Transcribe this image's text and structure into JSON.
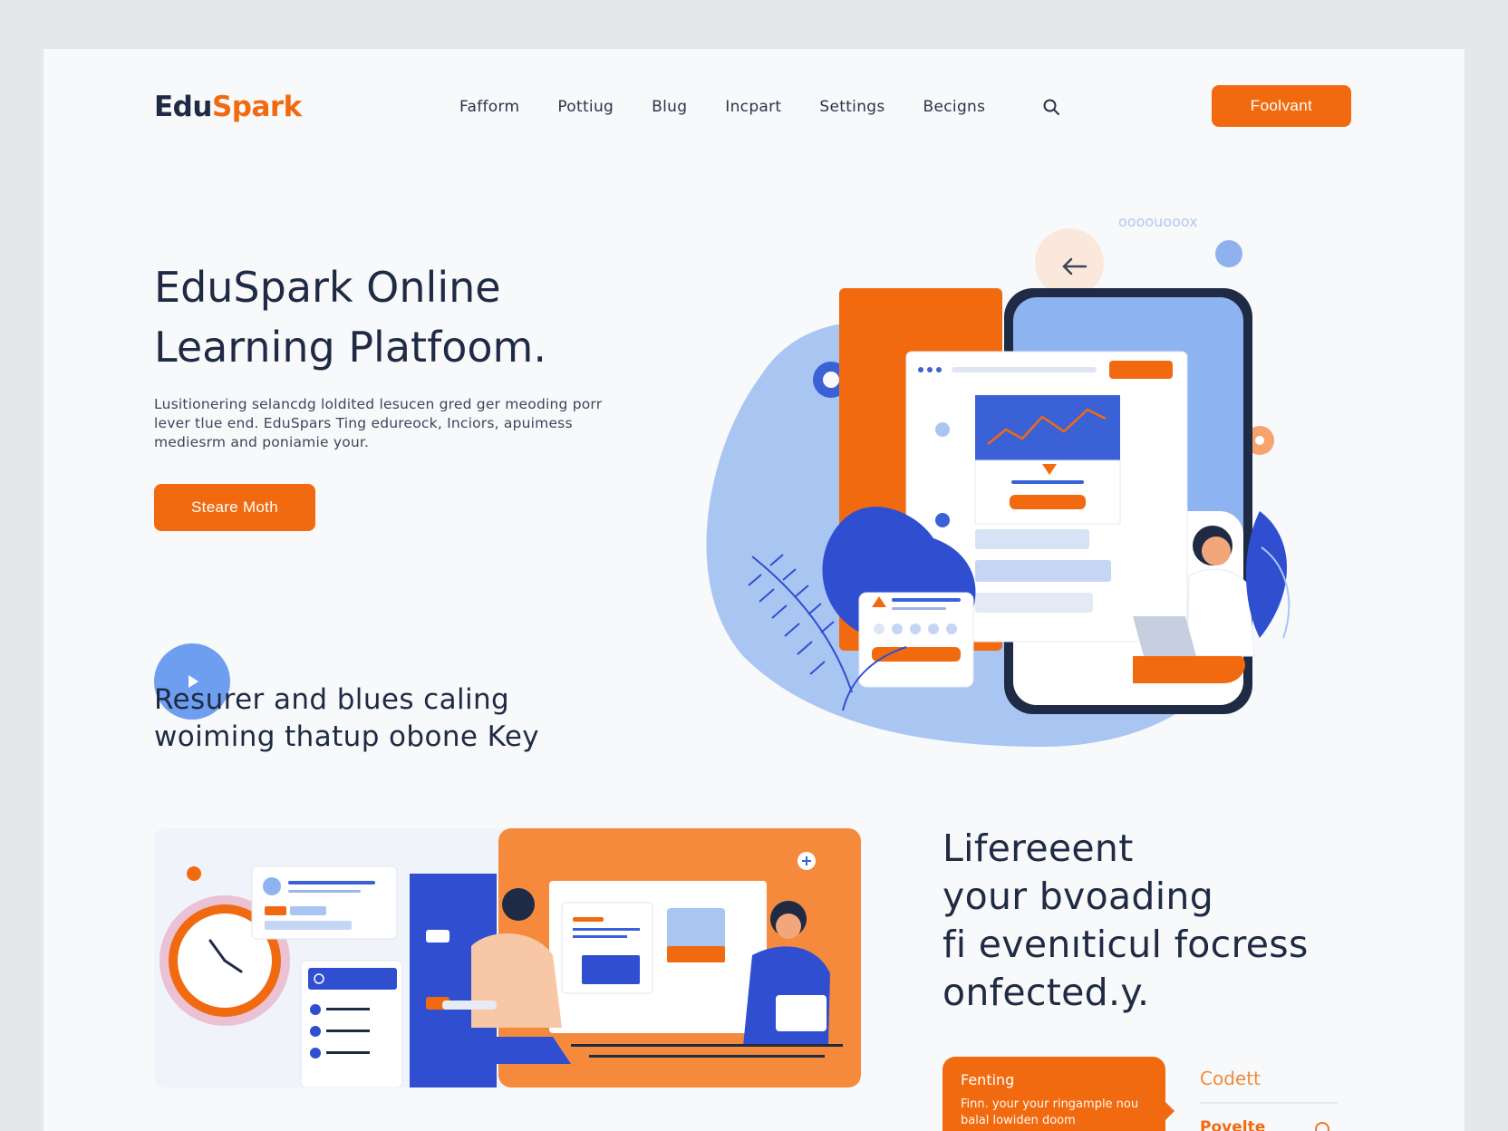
{
  "header": {
    "logo_part1": "Edu",
    "logo_part2": "Spark",
    "nav": [
      "Fafform",
      "Pottiug",
      "Blug",
      "Incpart",
      "Settings",
      "Becigns"
    ],
    "cta_label": "Foolvant",
    "search_icon": "search-icon"
  },
  "hero": {
    "title_line1": "EduSpark Online",
    "title_line2": "Learning Platfoom.",
    "description": "Lusitionering selancdg loldited lesucen gred ger meoding porr lever tlue end. EduSpars Ting edureock, Inciors, apuimess mediesrm and poniamie your.",
    "button_label": "Steare Moth",
    "illustration_label": "oooouooox"
  },
  "secondary": {
    "play_icon": "play-icon",
    "line1": "Resurer and blues caling",
    "line2": "woiming thatup obone Key"
  },
  "features": {
    "title_line1": "Lifereeent",
    "title_line2": "your bvoading",
    "title_line3": "fi evenıticul focress",
    "title_line4": "onfected.y.",
    "card_title": "Fenting",
    "card_text": "Finn. your your ringample nou balal lowiden doom",
    "link1": "Codett",
    "link2": "Povelte"
  },
  "colors": {
    "accent_orange": "#f26a10",
    "accent_blue": "#3a62d6",
    "light_blue": "#a9c6f2",
    "text_dark": "#1f2a44"
  }
}
